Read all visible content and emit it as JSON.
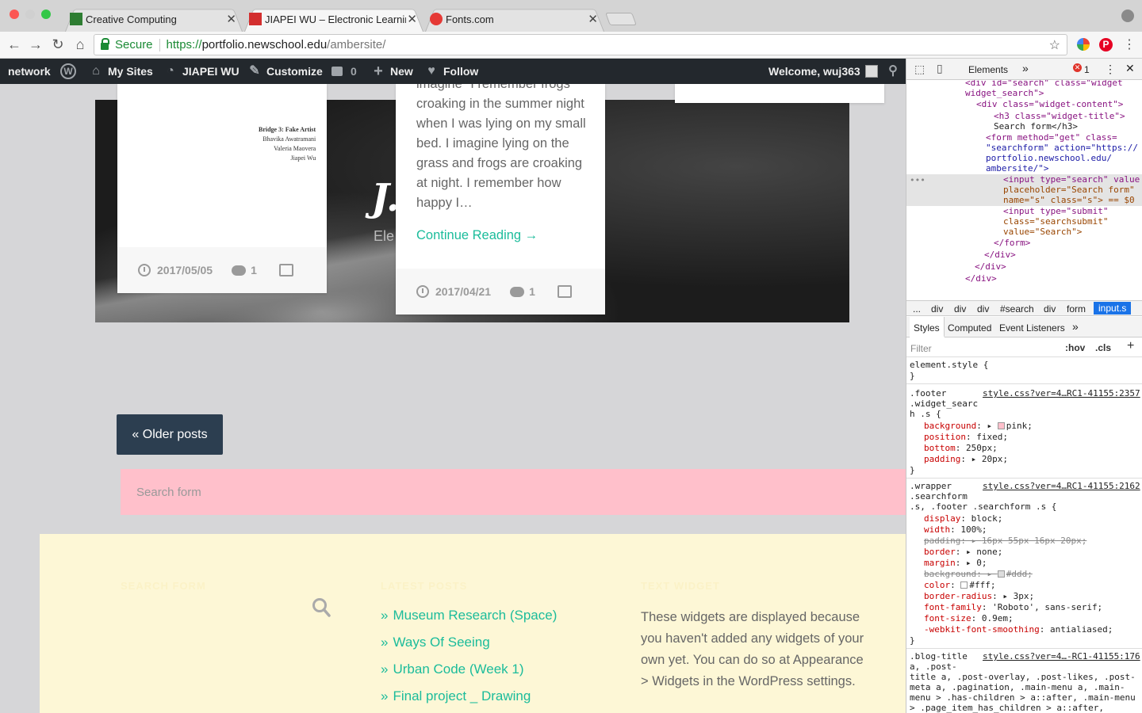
{
  "browser": {
    "tabs": [
      {
        "title": "Creative Computing",
        "favicon_color": "#2e7d32"
      },
      {
        "title": "JIAPEI WU – Electronic Learnin",
        "favicon_color": "#d32f2f"
      },
      {
        "title": "Fonts.com",
        "favicon_color": "#e53935"
      }
    ],
    "close_glyph": "✕",
    "secure_label": "Secure",
    "url_proto": "https://",
    "url_host": "portfolio.newschool.edu",
    "url_path": "/ambersite/",
    "ext_pinterest": "P"
  },
  "adminbar": {
    "network": "network",
    "my_sites": "My Sites",
    "site_name": "JIAPEI WU",
    "customize": "Customize",
    "comments_count": "0",
    "new": "New",
    "follow": "Follow",
    "welcome": "Welcome, wuj363"
  },
  "hero": {
    "title_fragment": "J.",
    "subtitle_fragment": "Ele"
  },
  "posts": [
    {
      "book_lines": [
        "Bridge 3: Fake Artist",
        "Bhavika Awatramani",
        "Valeria Maovera",
        "Jiapei Wu"
      ],
      "date": "2017/05/05",
      "comments": "1"
    },
    {
      "excerpt_top": "imagine \"I remember frogs",
      "excerpt": "croaking in the summer night when I was lying on my small bed. I imagine lying on the grass and frogs are croaking at night. I remember how happy I…",
      "continue": "Continue Reading →",
      "date": "2017/04/21",
      "comments": "1"
    }
  ],
  "older_posts": "« Older posts",
  "search": {
    "placeholder": "Search form"
  },
  "footer": {
    "search_title": "Search form",
    "latest_title": "Latest Posts",
    "text_title": "Text Widget",
    "latest_posts": [
      "Museum Research (Space)",
      "Ways Of Seeing",
      "Urban Code (Week 1)",
      "Final project _ Drawing"
    ],
    "bullet": "»",
    "text_body": "These widgets are displayed because you haven't added any widgets of your own yet. You can do so at Appearance > Widgets in the WordPress settings."
  },
  "devtools": {
    "tab_elements": "Elements",
    "more": "»",
    "error_count": "1",
    "breadcrumbs": [
      "...",
      "div",
      "div",
      "div",
      "#search",
      "div",
      "form",
      "input.s"
    ],
    "subtabs": [
      "Styles",
      "Computed",
      "Event Listeners",
      "»"
    ],
    "filter_label": "Filter",
    "hov": ":hov",
    "cls": ".cls",
    "plus": "+",
    "dom_lines": [
      "<div id=\"search\" class=\"widget",
      "widget_search\">",
      "<div class=\"widget-content\">",
      "<h3 class=\"widget-title\">",
      "Search form</h3>",
      "<form method=\"get\" class=",
      "\"searchform\" action=\"https://",
      "portfolio.newschool.edu/",
      "ambersite/\">",
      "<input type=\"search\" value",
      "placeholder=\"Search form\"",
      "name=\"s\" class=\"s\"> == $0",
      "<input type=\"submit\"",
      "class=\"searchsubmit\"",
      "value=\"Search\">",
      "</form>",
      "</div>",
      "</div>",
      "</div>"
    ],
    "rules": {
      "element_style": "element.style {",
      "close": "}",
      "footer_sel": ".footer",
      "footer_sel2": ".widget_searc",
      "footer_sel3": "h .s {",
      "footer_src": "style.css?ver=4…RC1-41155:2357",
      "footer_props": [
        [
          "background",
          "pink;"
        ],
        [
          "position",
          "fixed;"
        ],
        [
          "bottom",
          "250px;"
        ],
        [
          "padding",
          "20px;"
        ]
      ],
      "wrapper_sel": ".wrapper",
      "wrapper_sel2": ".searchform",
      "wrapper_sel3": ".s, .footer .searchform .s {",
      "wrapper_src": "style.css?ver=4…RC1-41155:2162",
      "wrapper_props": [
        [
          "display",
          "block;"
        ],
        [
          "width",
          "100%;"
        ],
        [
          "padding",
          "16px 55px 16px 20px;"
        ],
        [
          "border",
          "none;"
        ],
        [
          "margin",
          "0;"
        ],
        [
          "background",
          "#ddd;"
        ],
        [
          "color",
          "#fff;"
        ],
        [
          "border-radius",
          "3px;"
        ],
        [
          "font-family",
          "'Roboto', sans-serif;"
        ],
        [
          "font-size",
          "0.9em;"
        ],
        [
          "-webkit-font-smoothing",
          "antialiased;"
        ]
      ],
      "blog_sel": ".blog-title",
      "blog_src": "style.css?ver=4…-RC1-41155:176",
      "blog_lines": [
        "a, .post-",
        "title a, .post-overlay, .post-likes, .post-",
        "meta a, .pagination, .main-menu a, .main-",
        "menu > .has-children > a::after, .main-menu",
        "> .page_item_has_children > a::after,"
      ]
    }
  }
}
